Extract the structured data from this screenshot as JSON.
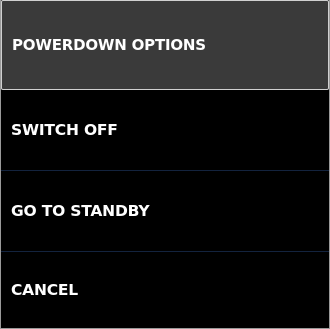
{
  "dialog": {
    "title": "POWERDOWN OPTIONS",
    "options": [
      {
        "label": "SWITCH OFF"
      },
      {
        "label": "GO TO STANDBY"
      },
      {
        "label": "CANCEL"
      }
    ]
  },
  "colors": {
    "background": "#000000",
    "header_background": "#3a3a3a",
    "text": "#ffffff",
    "separator": "#13233e",
    "border": "#9a9a9a"
  }
}
